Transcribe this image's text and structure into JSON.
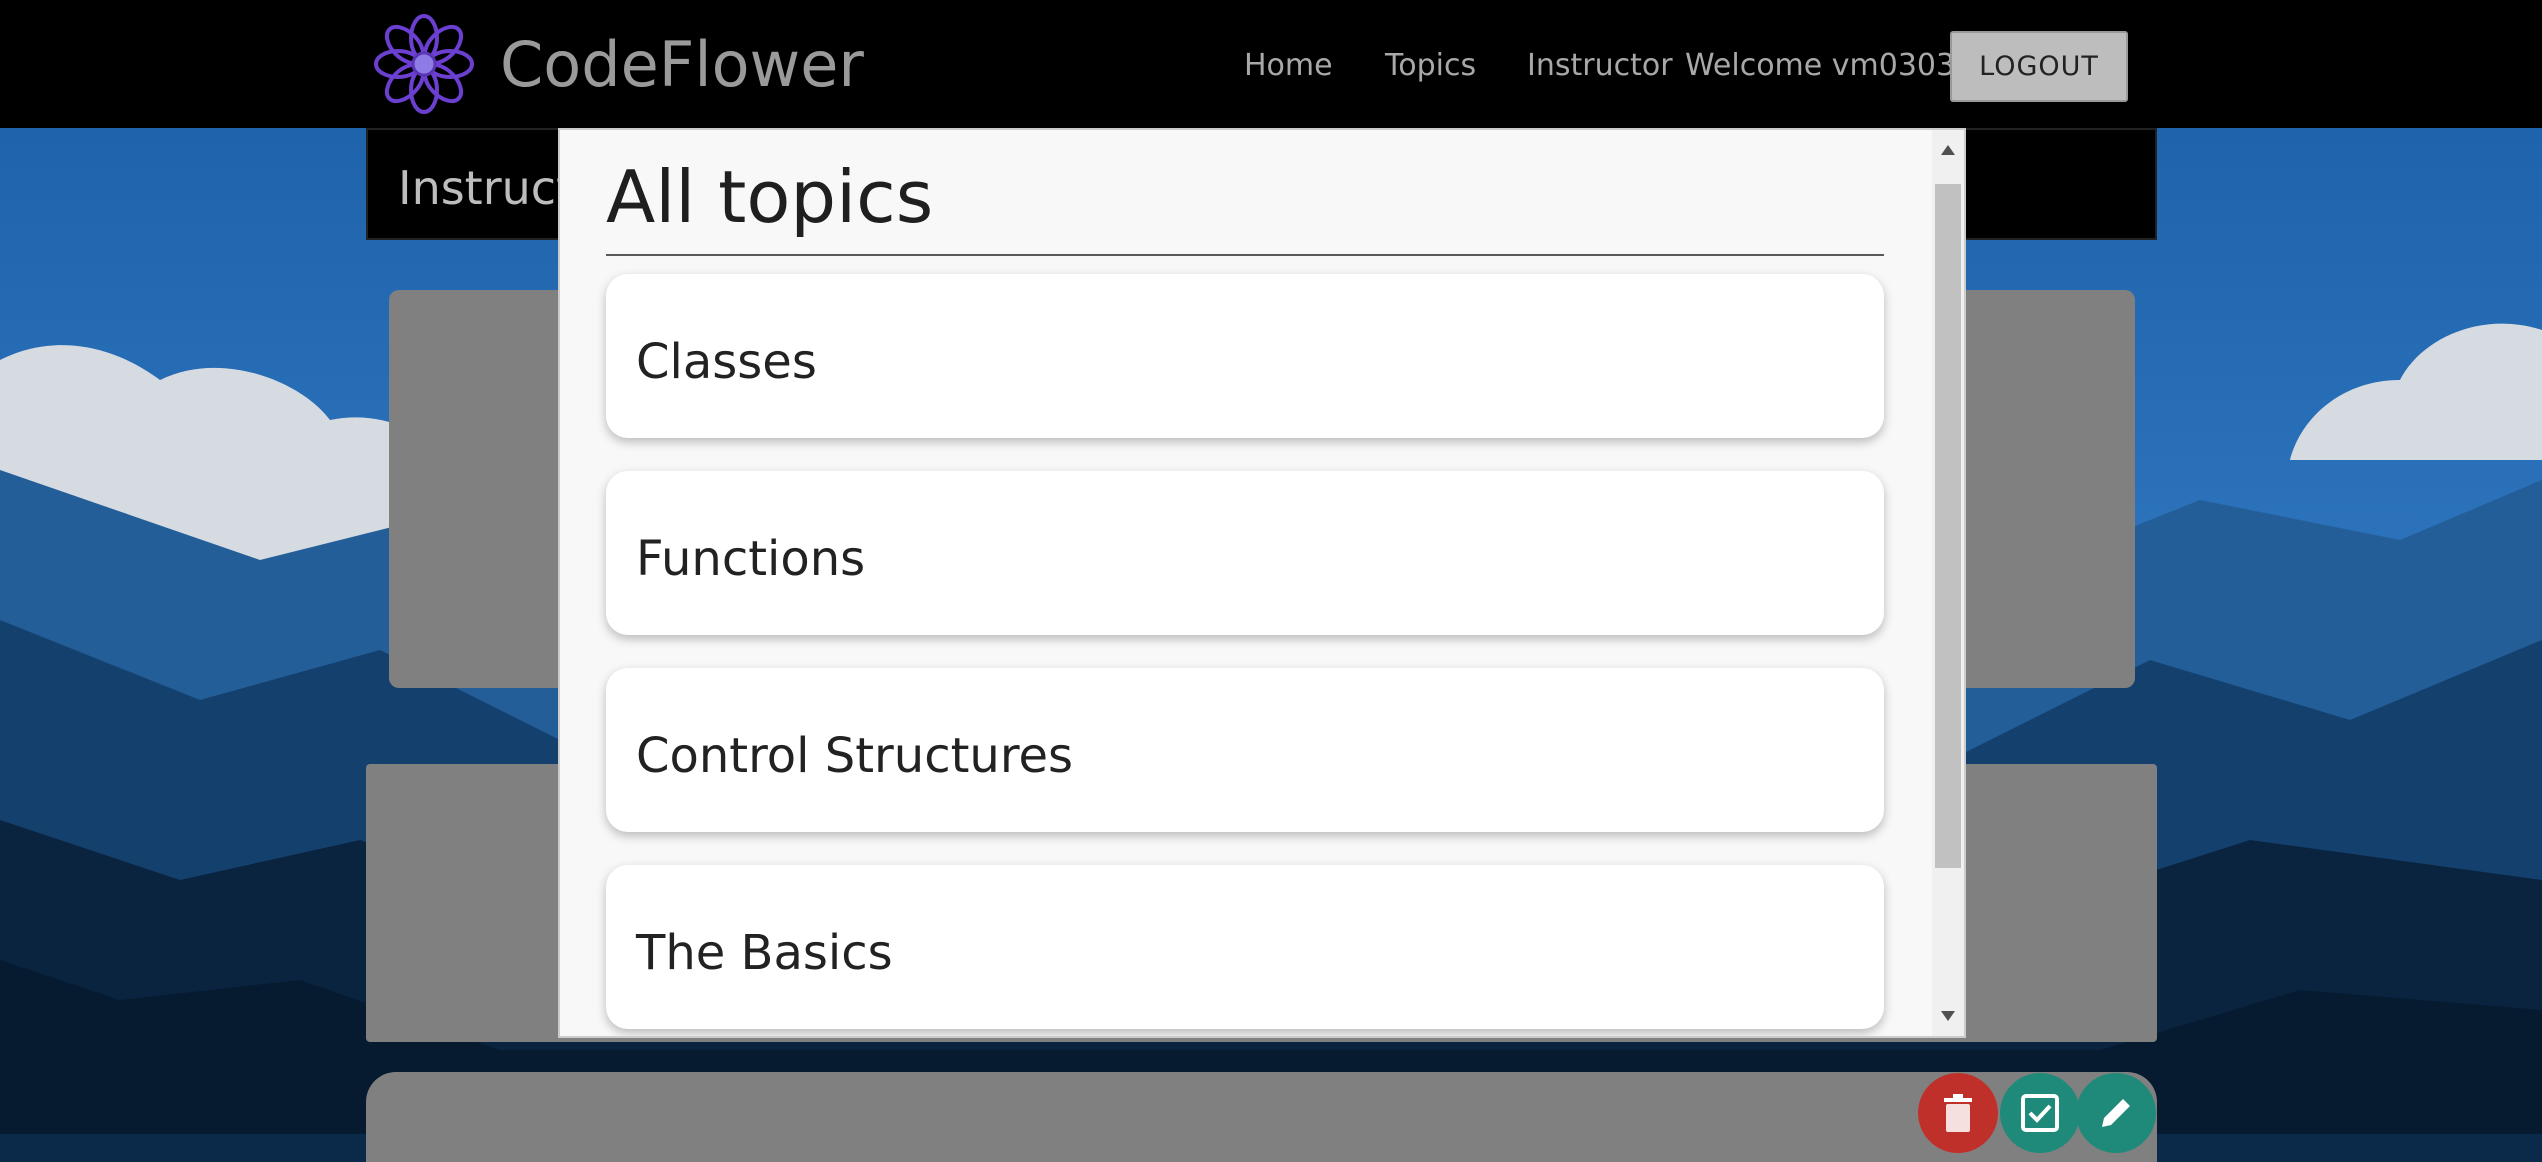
{
  "app": {
    "brand": "CodeFlower",
    "logo_icon": "flower-logo-icon"
  },
  "nav": {
    "home": "Home",
    "topics": "Topics",
    "instructor": "Instructor",
    "welcome": "Welcome vm0303",
    "logout": "LOGOUT"
  },
  "page": {
    "instructor_title": "Instructor"
  },
  "modal": {
    "title": "All topics",
    "topics": [
      {
        "label": "Classes"
      },
      {
        "label": "Functions"
      },
      {
        "label": "Control Structures"
      },
      {
        "label": "The Basics"
      }
    ]
  },
  "actions": {
    "delete_icon": "trash-icon",
    "check_icon": "checkbox-icon",
    "edit_icon": "pencil-icon"
  },
  "colors": {
    "navbar": "#000000",
    "brand_text": "#9a9a9a",
    "logo_purple": "#6b3fd0",
    "delete": "#c0302a",
    "check": "#1f8a7a",
    "edit": "#1f8a7a"
  }
}
